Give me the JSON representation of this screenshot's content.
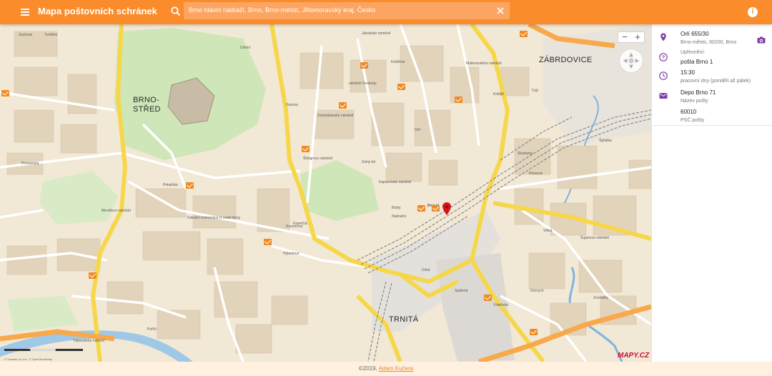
{
  "app": {
    "title": "Mapa poštovních schránek"
  },
  "search": {
    "value": "Brno hlavní nádraží, Brno, Brno-město, Jihomoravský kraj, Česko"
  },
  "map": {
    "districts": [
      "BRNO-",
      "STŘED",
      "ZÁBRDOVICE",
      "TRNITÁ"
    ],
    "labels": [
      "Zachova",
      "Tvrdého",
      "Údolní",
      "Jakubské náměstí",
      "Kobližná",
      "náměstí Svobody",
      "Malinovského náměstí",
      "Dominikánské náměstí",
      "Šilingrovo náměstí",
      "Zelný trh",
      "Kapucínské náměstí",
      "Pekařská",
      "Husova",
      "Mendlovo náměstí",
      "Křenová",
      "Nádražní",
      "Úzká",
      "Dornych",
      "Hybešova",
      "Pivovarská",
      "Kounicova",
      "Koliště",
      "Cejl",
      "Šujanovo náměstí",
      "Vídeňská",
      "Poříčí",
      "Zvonařka",
      "Vlhká",
      "Špitálka",
      "Skořepka",
      "Spálená",
      "Kopečná",
      "Bašty",
      "Orlí",
      "Fakultní nemocnice U svaté Anny",
      "Táborského nábřeží"
    ],
    "station_label": "Brno hl.",
    "brand": "MAPY.CZ",
    "attribution": "© Seznam.cz, a.s., © OpenStreetMap",
    "zoom_in": "+",
    "zoom_out": "−"
  },
  "panel": {
    "address": {
      "line1": "Orlí 655/30",
      "line2": "Brno-město, 60200, Brno"
    },
    "specification": {
      "label": "Upřesnění:",
      "value": "pošta Brno 1"
    },
    "time": {
      "value": "15:30",
      "note": "pracovní dny (pondělí až pátek)"
    },
    "depot": {
      "name": "Depo Brno 71",
      "name_label": "Název pošty",
      "zip": "60010",
      "zip_label": "PSČ pošty"
    }
  },
  "footer": {
    "text": "©2019, ",
    "author": "Adam Kučera"
  },
  "colors": {
    "accent": "#fb8c2c",
    "panel_icon": "#7b3fa6",
    "pin": "#d0161a"
  }
}
